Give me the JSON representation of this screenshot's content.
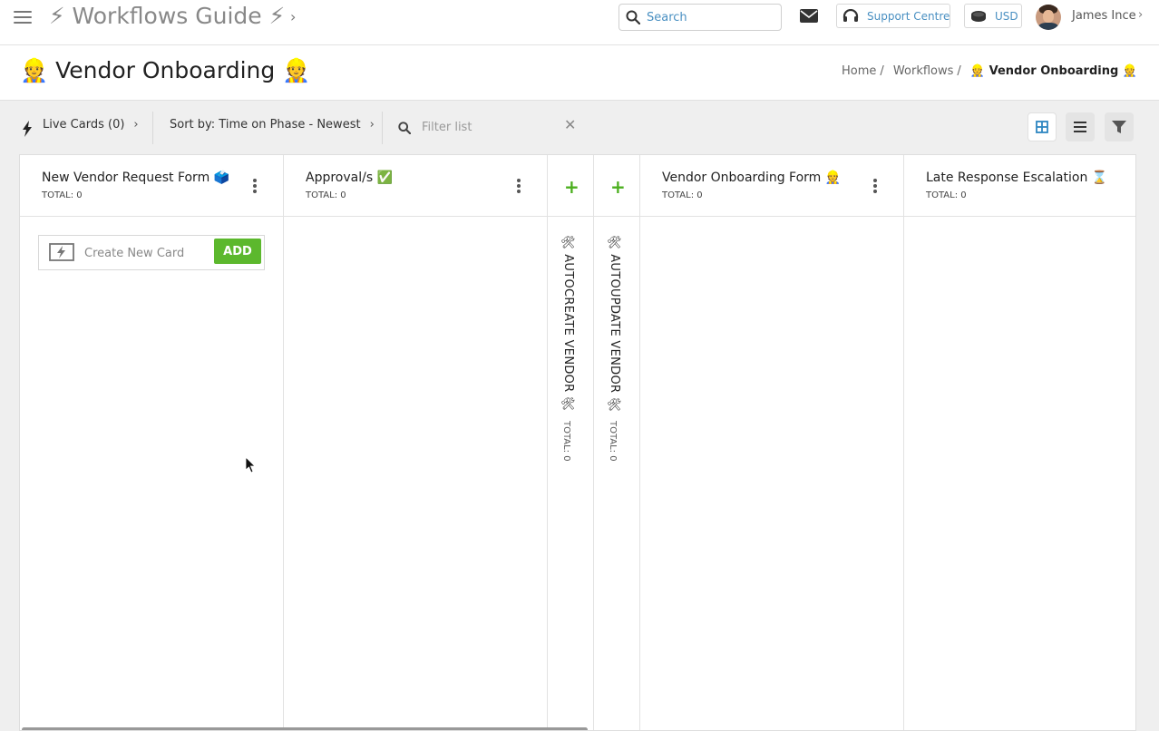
{
  "topbar": {
    "app_title": "⚡ Workflows Guide ⚡",
    "search_placeholder": "Search",
    "support_label": "Support Centre",
    "currency_label": "USD",
    "user_name": "James Ince"
  },
  "header": {
    "title": "👷 Vendor Onboarding 👷",
    "breadcrumb": {
      "home": "Home",
      "workflows": "Workflows",
      "current": "👷 Vendor Onboarding 👷"
    }
  },
  "toolbar": {
    "live_cards": "Live Cards (0)",
    "sort_by": "Sort by: Time on Phase - Newest",
    "filter_placeholder": "Filter list"
  },
  "columns": [
    {
      "title": "New Vendor Request Form 🗳️",
      "total": "TOTAL: 0"
    },
    {
      "title": "Approval/s ✅",
      "total": "TOTAL: 0"
    },
    {
      "title": "🛠 AUTOCREATE VENDOR 🛠",
      "total": "TOTAL: 0"
    },
    {
      "title": "🛠 AUTOUPDATE VENDOR 🛠",
      "total": "TOTAL: 0"
    },
    {
      "title": "Vendor Onboarding Form 👷",
      "total": "TOTAL: 0"
    },
    {
      "title": "Late Response Escalation ⌛",
      "total": "TOTAL: 0"
    }
  ],
  "create_card": {
    "placeholder": "Create New Card",
    "add_label": "ADD"
  },
  "colors": {
    "accent_blue": "#4a90c2",
    "add_green": "#5cb82d",
    "plus_green": "#4caf1f"
  }
}
